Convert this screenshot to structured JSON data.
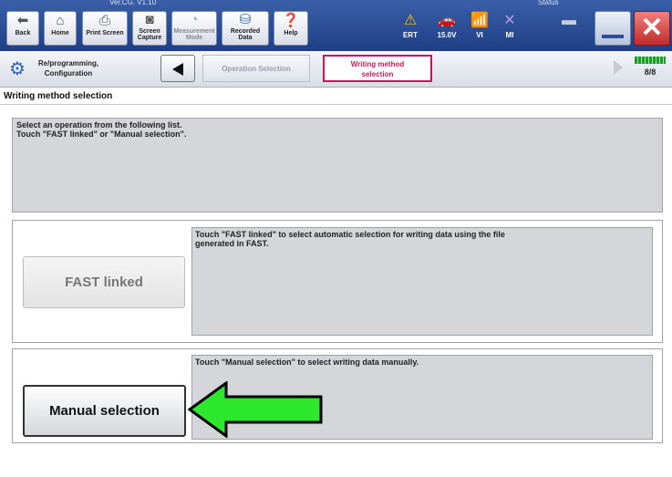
{
  "toolbar": {
    "version_text": "Ver.CG. V1.10",
    "status_text": "Status",
    "buttons": [
      {
        "label": "Back",
        "icon": "back-arrow-icon"
      },
      {
        "label": "Home",
        "icon": "home-icon"
      },
      {
        "label": "Print Screen",
        "icon": "printer-icon"
      },
      {
        "label": "Screen\nCapture",
        "icon": "camera-icon"
      },
      {
        "label": "Measurement\nMode",
        "icon": "meter-icon"
      },
      {
        "label": "Recorded\nData",
        "icon": "recorded-data-icon"
      },
      {
        "label": "Help",
        "icon": "help-icon"
      },
      {
        "label": "ERT",
        "icon": "warning-icon"
      }
    ],
    "voltage": "15.0V",
    "vi_label": "VI",
    "mi_label": "MI",
    "close_glyph": "✕"
  },
  "breadcrumb": {
    "root_label": "Re/programming,\nConfiguration",
    "prev_step": "Operation Selection",
    "current_step": "Writing method\nselection",
    "progress_text": "8/8",
    "progress_fraction": 1.0
  },
  "section_title": "Writing method selection",
  "instruction": "Select an operation from the following list.\nTouch \"FAST linked\" or \"Manual selection\".",
  "options": [
    {
      "button_label": "FAST linked",
      "description": "Touch \"FAST linked\" to select automatic selection for writing data using the file\ngenerated in FAST.",
      "enabled": false
    },
    {
      "button_label": "Manual selection",
      "description": "Touch \"Manual selection\" to select writing data manually.",
      "enabled": true
    }
  ],
  "colors": {
    "toolbar_bg": "#1e3f86",
    "current_step_border": "#c2185b",
    "arrow_fill": "#2ee82e",
    "progress_green": "#1c9e2a"
  }
}
